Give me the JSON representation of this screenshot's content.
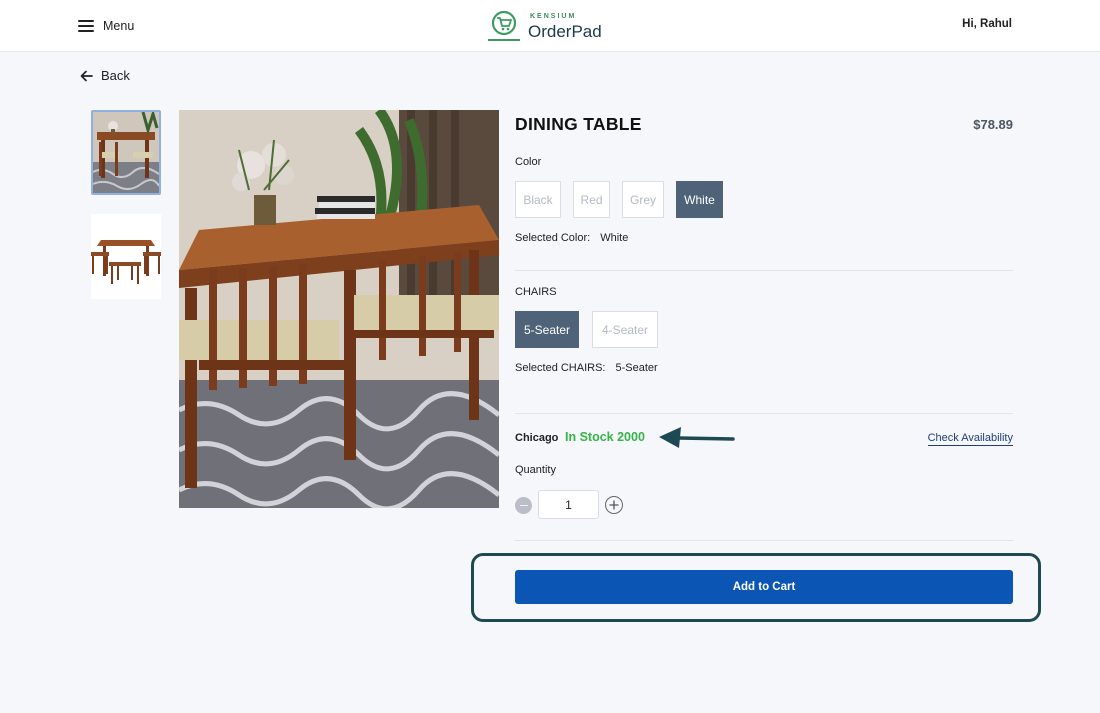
{
  "header": {
    "menu_label": "Menu",
    "logo_small": "KENSIUM",
    "logo_big": "OrderPad",
    "greeting": "Hi, Rahul"
  },
  "nav": {
    "back_label": "Back"
  },
  "product": {
    "title": "DINING TABLE",
    "price": "$78.89",
    "color_label": "Color",
    "colors": [
      "Black",
      "Red",
      "Grey",
      "White"
    ],
    "selected_color_label": "Selected Color:",
    "selected_color": "White",
    "chairs_label": "CHAIRS",
    "chairs": [
      "5-Seater",
      "4-Seater"
    ],
    "selected_chairs_label": "Selected CHAIRS:",
    "selected_chairs": "5-Seater",
    "location": "Chicago",
    "stock_text": "In Stock 2000",
    "check_availability": "Check Availability",
    "quantity_label": "Quantity",
    "quantity_value": "1",
    "add_to_cart": "Add to Cart"
  },
  "colors": {
    "primary": "#0b55b4",
    "selected_option": "#4f6378",
    "in_stock": "#37b34a",
    "annotation": "#1d4a52"
  }
}
